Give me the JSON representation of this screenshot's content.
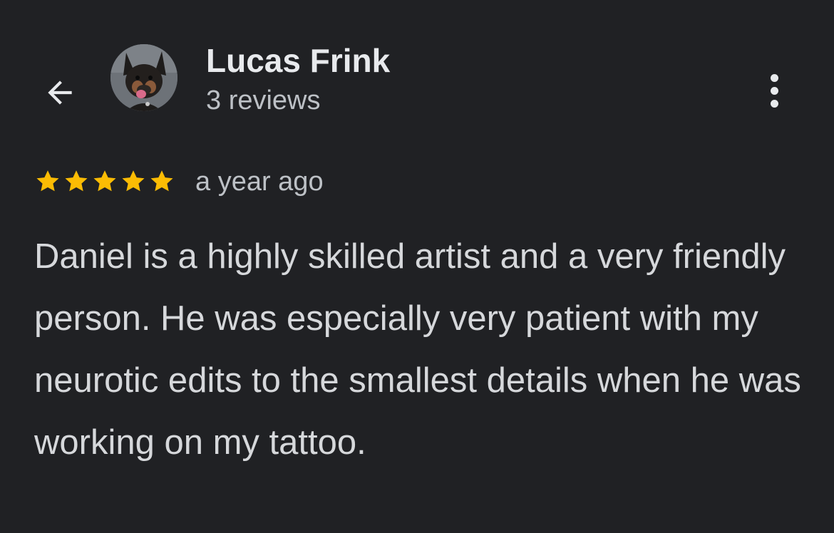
{
  "header": {
    "back_icon": "arrow-back-icon",
    "avatar_icon": "dog-avatar-photo",
    "reviewer_name": "Lucas Frink",
    "review_count": "3 reviews",
    "more_icon": "more-vertical-icon"
  },
  "review": {
    "rating": 5,
    "rating_max": 5,
    "star_color": "#fbbc04",
    "time_ago": "a year ago",
    "text": "Daniel is a highly skilled artist and a very friendly person. He was especially very patient with my neurotic edits to the smallest details when he was working on my tattoo."
  }
}
